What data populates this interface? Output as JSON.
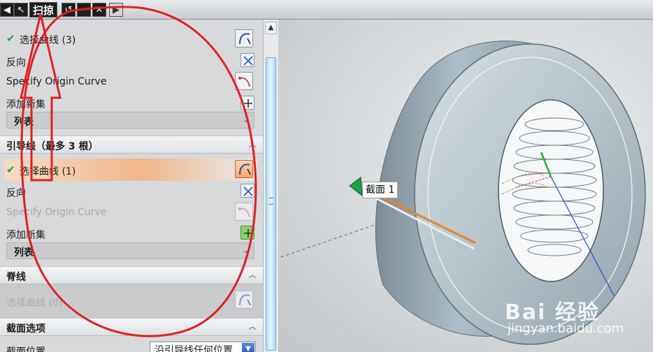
{
  "dialog": {
    "title": "扫掠",
    "title_buttons": [
      "◀",
      "↖",
      "↺",
      "−",
      "✕",
      "▶"
    ]
  },
  "section_curves": {
    "select_curve": "选择曲线 (3)",
    "reverse": "反向",
    "specify_origin_curve": "Specify Origin Curve",
    "add_new_set": "添加新集",
    "list": "列表"
  },
  "section_guides": {
    "header": "引导线（最多 3 根）",
    "select_curve": "选择曲线 (1)",
    "reverse": "反向",
    "specify_origin_curve": "Specify Origin Curve",
    "add_new_set": "添加新集",
    "list": "列表"
  },
  "section_spine": {
    "header": "脊线",
    "select_curve": "选择曲线 (0)"
  },
  "section_options": {
    "header": "截面选项",
    "position_label": "截面位置",
    "position_value": "沿引导线任何位置"
  },
  "viewport": {
    "callout": "截面 1",
    "watermark_top": "Bai 经验",
    "watermark_bottom": "jingyan.baidu.com"
  },
  "colors": {
    "check_green": "#22a52a",
    "selected_orange": "#f1b889",
    "annotation_red": "#e02020"
  }
}
